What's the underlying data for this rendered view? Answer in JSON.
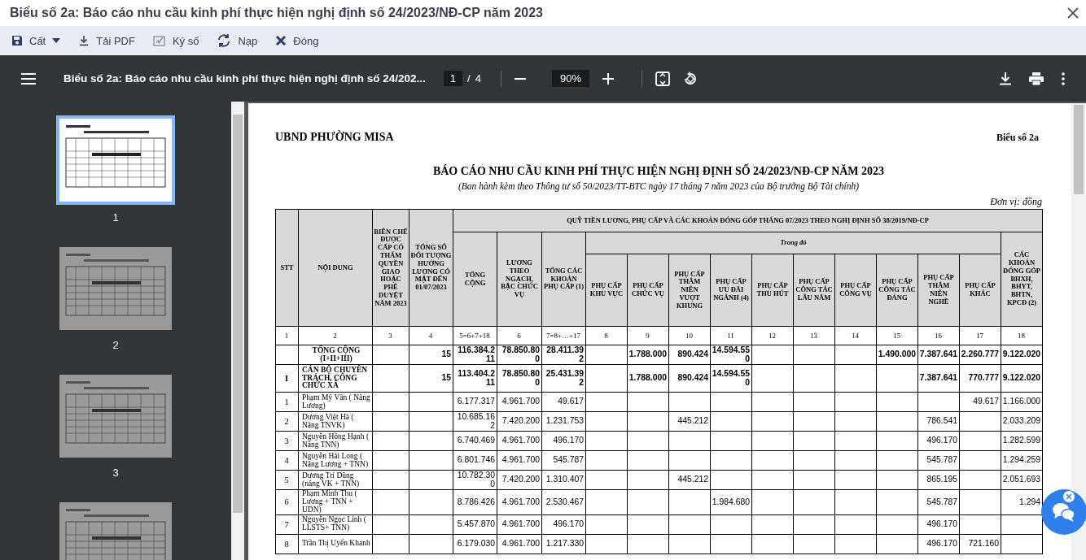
{
  "window": {
    "title": "Biểu số 2a: Báo cáo nhu cầu kinh phí thực hiện nghị định số 24/2023/NĐ-CP năm 2023"
  },
  "toolbar": [
    {
      "label": "Cất",
      "dropdown": true
    },
    {
      "label": "Tải PDF",
      "dropdown": false
    },
    {
      "label": "Ký số",
      "dropdown": false
    },
    {
      "label": "Nạp",
      "dropdown": false
    },
    {
      "label": "Đóng",
      "dropdown": false
    }
  ],
  "viewer": {
    "title": "Biểu số 2a: Báo cáo nhu cầu kinh phí thực hiện nghị định số 24/202...",
    "page": "1",
    "separator": "/",
    "page_count": "4",
    "zoom": "90%"
  },
  "thumbnails": [
    {
      "label": "1",
      "selected": true
    },
    {
      "label": "2",
      "selected": false
    },
    {
      "label": "3",
      "selected": false
    },
    {
      "selected": false
    }
  ],
  "document": {
    "org": "UBND PHƯỜNG MISA",
    "form_code": "Biểu số 2a",
    "title": "BÁO CÁO NHU CẦU KINH PHÍ THỰC HIỆN NGHỊ ĐỊNH SỐ 24/2023/NĐ-CP NĂM 2023",
    "subtitle": "(Ban hành kèm theo Thông tư số 50/2023/TT-BTC ngày 17 tháng 7 năm 2023 của Bộ trưởng Bộ Tài chính)",
    "unit": "Đơn vị: đồng",
    "table": {
      "group": "QUỸ TIỀN LƯƠNG, PHỤ CẤP VÀ CÁC KHOẢN ĐÓNG GÓP THÁNG 07/2023 THEO NGHỊ ĐỊNH SỐ 38/2019/NĐ-CP",
      "subgroup": "Trong đó",
      "columns": [
        "STT",
        "NỘI DUNG",
        "BIÊN CHẾ ĐƯỢC CẤP CÓ THẨM QUYỀN GIAO HOẶC PHÊ DUYỆT NĂM 2023",
        "TỔNG SỐ ĐỐI TƯỢNG HƯỞNG LƯƠNG CÓ MẶT ĐẾN 01/07/2023",
        "TỔNG CỘNG",
        "LƯƠNG THEO NGẠCH, BẬC CHỨC VỤ",
        "TỔNG CÁC KHOẢN PHỤ CẤP (1)",
        "PHỤ CẤP KHU VỰC",
        "PHỤ CẤP CHỨC VỤ",
        "PHỤ CẤP THÂM NIÊN VƯỢT KHUNG",
        "PHỤ CẤP ƯU ĐÃI NGÀNH (4)",
        "PHỤ CẤP THU HÚT",
        "PHỤ CẤP CÔNG TÁC LÂU NĂM",
        "PHỤ CẤP CÔNG VỤ",
        "PHỤ CẤP CÔNG TÁC ĐẢNG",
        "PHỤ CẤP THÂM NIÊN NGHỀ",
        "PHỤ CẤP KHÁC",
        "CÁC KHOẢN ĐÓNG GÓP BHXH, BHYT, BHTN, KPCĐ (2)"
      ],
      "column_numbers": [
        "1",
        "2",
        "3",
        "4",
        "5=6+7+18",
        "6",
        "7=8+…+17",
        "8",
        "9",
        "10",
        "11",
        "12",
        "13",
        "14",
        "15",
        "16",
        "17",
        "18"
      ],
      "rows": [
        {
          "kind": "total",
          "cells": [
            null,
            "TỔNG CỘNG (I+II+III)",
            null,
            "15",
            "116.384.211",
            "78.850.800",
            "28.411.392",
            null,
            "1.788.000",
            "890.424",
            "14.594.550",
            null,
            null,
            null,
            "1.490.000",
            "7.387.641",
            "2.260.777",
            "9.122.020"
          ]
        },
        {
          "kind": "section",
          "cells": [
            "I",
            "CÁN BỘ CHUYÊN TRÁCH, CÔNG CHỨC XÃ",
            null,
            "15",
            "113.404.211",
            "78.850.800",
            "25.431.392",
            null,
            "1.788.000",
            "890.424",
            "14.594.550",
            null,
            null,
            null,
            null,
            "7.387.641",
            "770.777",
            "9.122.020"
          ]
        },
        {
          "kind": "person",
          "cells": [
            "1",
            "Phạm Mỹ Vân ( Nâng Lương)",
            null,
            null,
            "6.177.317",
            "4.961.700",
            "49.617",
            null,
            null,
            null,
            null,
            null,
            null,
            null,
            null,
            null,
            "49.617",
            "1.166.000"
          ]
        },
        {
          "kind": "person",
          "cells": [
            "2",
            "Dương Việt Hà ( Nâng TNVK)",
            null,
            null,
            "10.685.162",
            "7.420.200",
            "1.231.753",
            null,
            null,
            "445.212",
            null,
            null,
            null,
            null,
            null,
            "786.541",
            null,
            "2.033.209"
          ]
        },
        {
          "kind": "person",
          "cells": [
            "3",
            "Nguyễn Hồng Hạnh ( Nâng TNN)",
            null,
            null,
            "6.740.469",
            "4.961.700",
            "496.170",
            null,
            null,
            null,
            null,
            null,
            null,
            null,
            null,
            "496.170",
            null,
            "1.282.599"
          ]
        },
        {
          "kind": "person",
          "cells": [
            "4",
            "Nguyễn Hải Long ( Nâng Lương + TNN)",
            null,
            null,
            "6.801.746",
            "4.961.700",
            "545.787",
            null,
            null,
            null,
            null,
            null,
            null,
            null,
            null,
            "545.787",
            null,
            "1.294.259"
          ]
        },
        {
          "kind": "person",
          "cells": [
            "5",
            "Dương Trí Dũng (nâng VK  + TNN)",
            null,
            null,
            "10.782.300",
            "7.420.200",
            "1.310.407",
            null,
            null,
            "445.212",
            null,
            null,
            null,
            null,
            null,
            "865.195",
            null,
            "2.051.693"
          ]
        },
        {
          "kind": "person",
          "cells": [
            "6",
            "Phạm Minh Thu ( Lương + TNN + UDN)",
            null,
            null,
            "8.786.426",
            "4.961.700",
            "2.530.467",
            null,
            null,
            null,
            "1.984.680",
            null,
            null,
            null,
            null,
            "545.787",
            null,
            "1.294"
          ]
        },
        {
          "kind": "person",
          "cells": [
            "7",
            "Nguyễn Ngọc Linh ( LLSTS+ TNN)",
            null,
            null,
            "5.457.870",
            "4.961.700",
            "496.170",
            null,
            null,
            null,
            null,
            null,
            null,
            null,
            null,
            "496.170",
            null,
            null
          ]
        },
        {
          "kind": "person",
          "cells": [
            "8",
            "Trần Thị Uyển Khanh",
            null,
            null,
            "6.179.030",
            "4.961.700",
            "1.217.330",
            null,
            null,
            null,
            null,
            null,
            null,
            null,
            null,
            "496.170",
            "721.160",
            null
          ]
        }
      ]
    }
  }
}
